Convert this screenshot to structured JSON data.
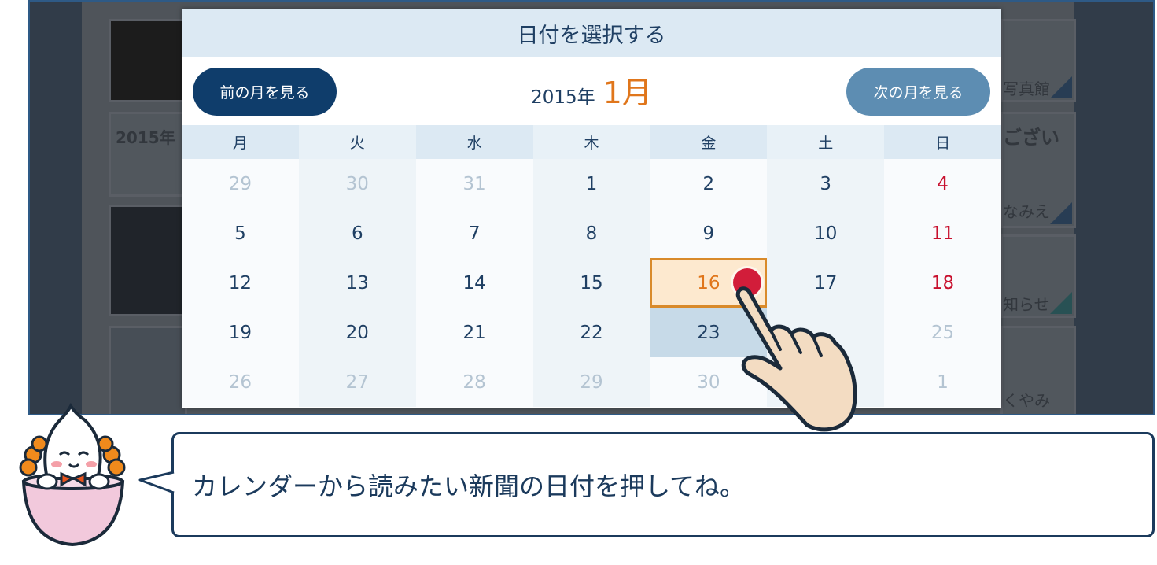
{
  "background": {
    "tile_texts": [
      "2015年",
      "写真館",
      "ござい",
      "なみえ",
      "知らせ",
      "くやみ"
    ]
  },
  "modal": {
    "title": "日付を選択する",
    "prev_button": "前の月を見る",
    "next_button": "次の月を見る",
    "year": "2015年",
    "month": "1月"
  },
  "calendar": {
    "weekdays": [
      "月",
      "火",
      "水",
      "木",
      "金",
      "土",
      "日"
    ],
    "weeks": [
      [
        "29",
        "30",
        "31",
        "1",
        "2",
        "3",
        "4"
      ],
      [
        "5",
        "6",
        "7",
        "8",
        "9",
        "10",
        "11"
      ],
      [
        "12",
        "13",
        "14",
        "15",
        "16",
        "17",
        "18"
      ],
      [
        "19",
        "20",
        "21",
        "22",
        "23",
        "",
        "25"
      ],
      [
        "26",
        "27",
        "28",
        "29",
        "30",
        "",
        "1"
      ]
    ],
    "selected_date": "16",
    "highlighted_date": "23"
  },
  "instruction": {
    "text": "カレンダーから読みたい新聞の日付を押してね。"
  },
  "colors": {
    "primary": "#0f3d6b",
    "accent": "#e0761b",
    "sunday": "#c8102e",
    "header_bg": "#dce9f3"
  },
  "icons": {
    "pointer": "pointing-hand-icon",
    "mascot": "mascot-character-icon",
    "touch": "touch-point-icon"
  }
}
